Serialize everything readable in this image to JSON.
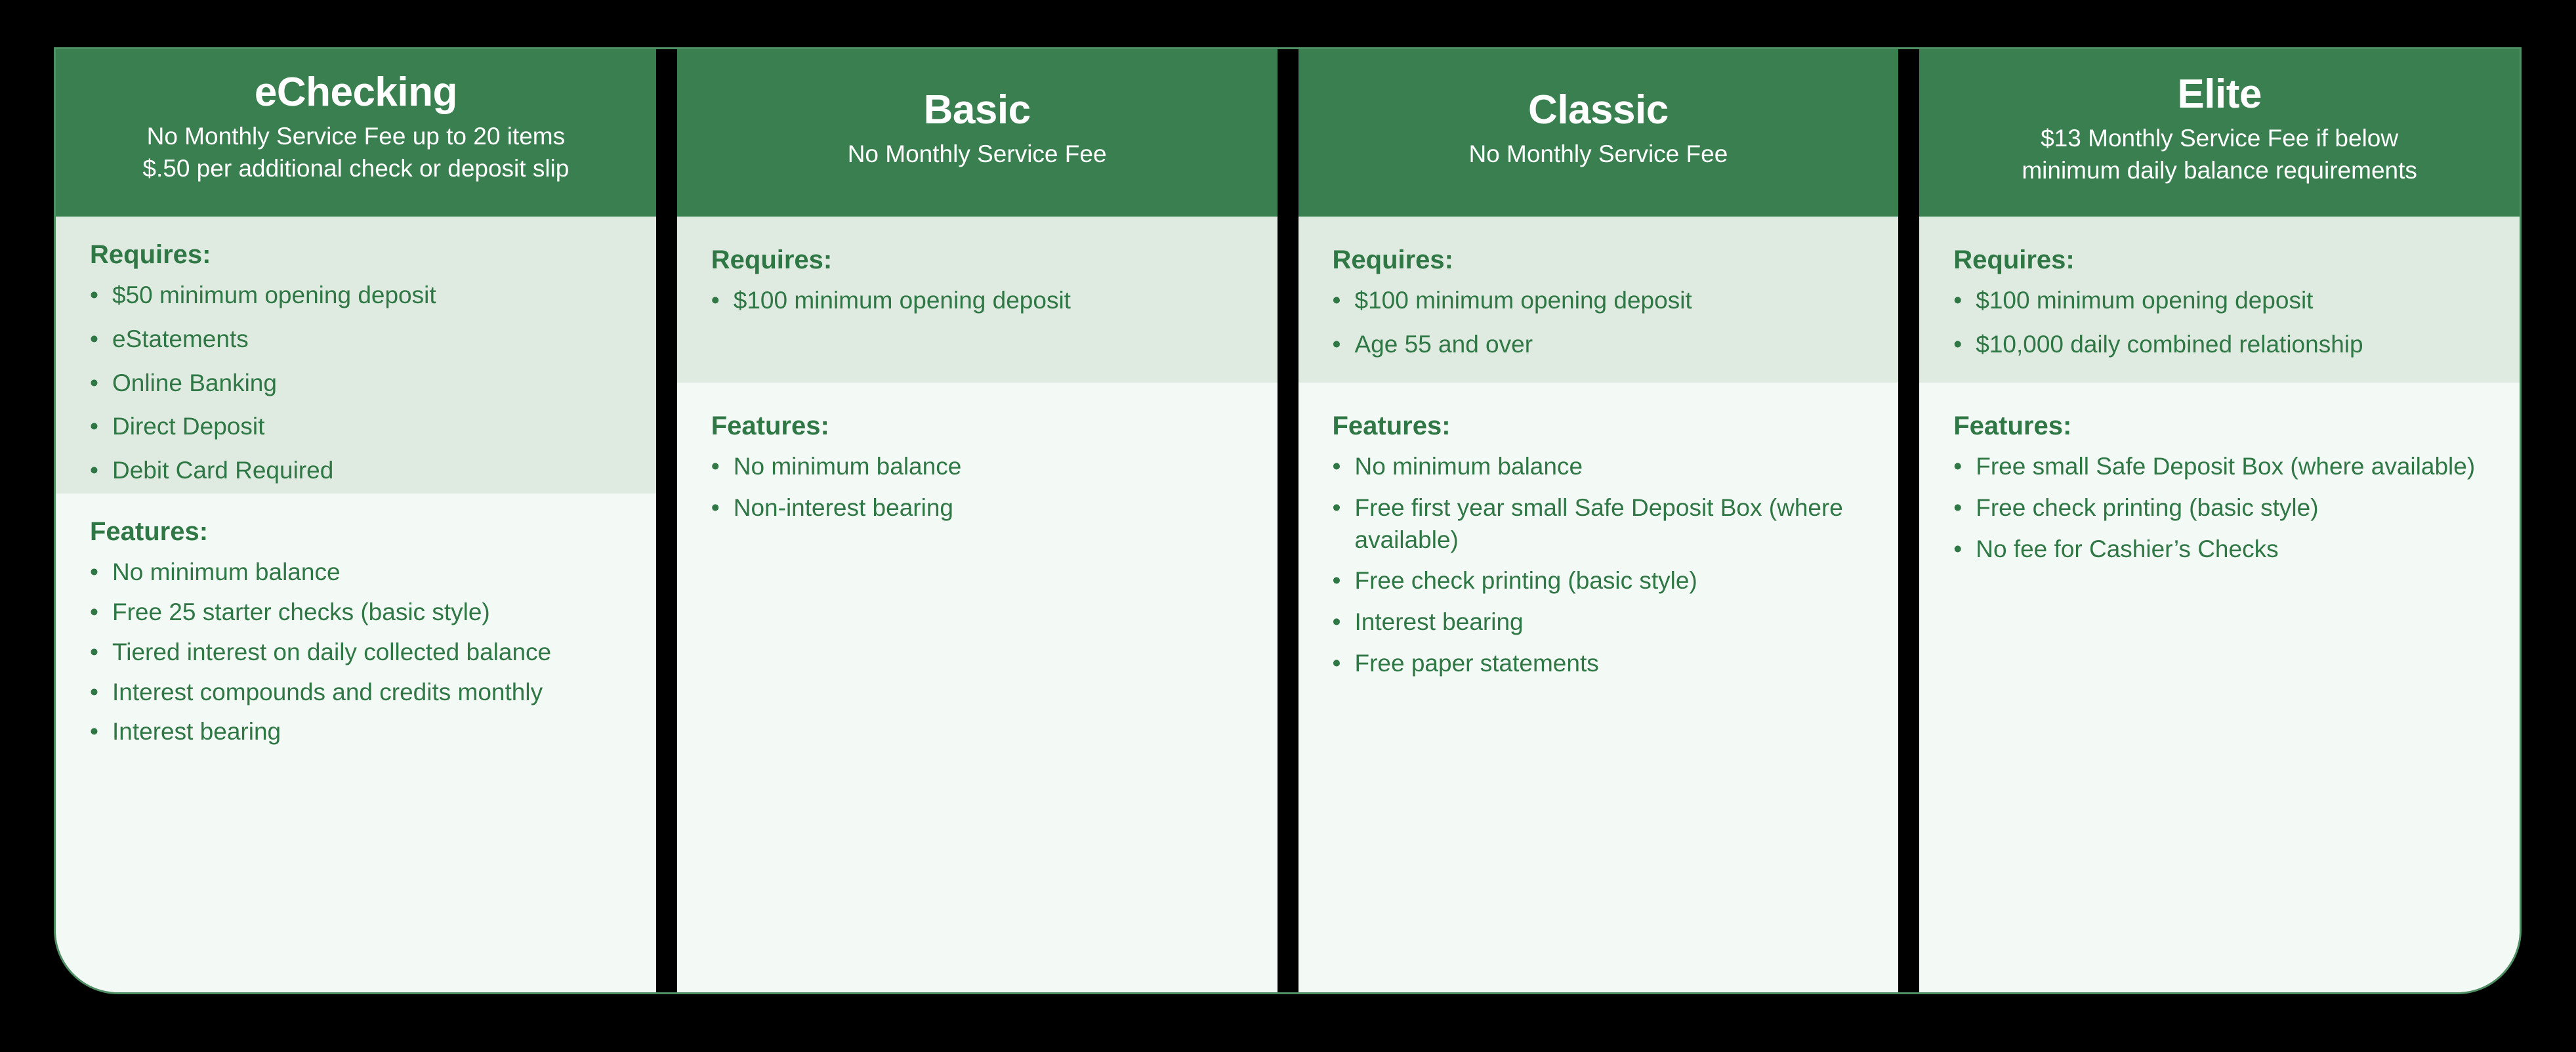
{
  "theme": {
    "page_background": "#000000",
    "header_green": "#3a7f50",
    "requires_background": "#dfeae1",
    "features_background": "#f3f9f5",
    "text_green": "#2f7744",
    "header_text": "#ffffff",
    "card_border": "#4e8f64"
  },
  "labels": {
    "requires_heading": "Requires:",
    "features_heading": "Features:",
    "bullet_glyph": "•"
  },
  "plans": [
    {
      "name": "eChecking",
      "subtitle_lines": [
        "No Monthly Service Fee up to 20 items",
        "$.50 per additional check or deposit slip"
      ],
      "requires_heading": "Requires:",
      "requires": [
        "$50 minimum opening deposit",
        "eStatements",
        "Online Banking",
        "Direct Deposit",
        "Debit Card Required"
      ],
      "features_heading": "Features:",
      "features": [
        "No minimum balance",
        "Free 25 starter checks (basic style)",
        "Tiered interest on daily collected balance",
        "Interest compounds and credits monthly",
        "Interest bearing"
      ]
    },
    {
      "name": "Basic",
      "subtitle_lines": [
        "No Monthly Service Fee"
      ],
      "requires_heading": "Requires:",
      "requires": [
        "$100 minimum opening deposit"
      ],
      "features_heading": "Features:",
      "features": [
        "No minimum balance",
        "Non-interest bearing"
      ]
    },
    {
      "name": "Classic",
      "subtitle_lines": [
        "No Monthly Service Fee"
      ],
      "requires_heading": "Requires:",
      "requires": [
        "$100 minimum opening deposit",
        "Age 55 and over"
      ],
      "features_heading": "Features:",
      "features": [
        "No minimum balance",
        "Free first year small Safe Deposit Box (where available)",
        "Free check printing (basic style)",
        "Interest bearing",
        "Free paper statements"
      ]
    },
    {
      "name": "Elite",
      "subtitle_lines": [
        "$13 Monthly Service Fee if below",
        "minimum daily balance requirements"
      ],
      "requires_heading": "Requires:",
      "requires": [
        "$100 minimum opening deposit",
        "$10,000 daily combined relationship"
      ],
      "features_heading": "Features:",
      "features": [
        "Free small Safe Deposit Box (where available)",
        "Free check printing (basic style)",
        "No fee for Cashier’s Checks"
      ]
    }
  ]
}
